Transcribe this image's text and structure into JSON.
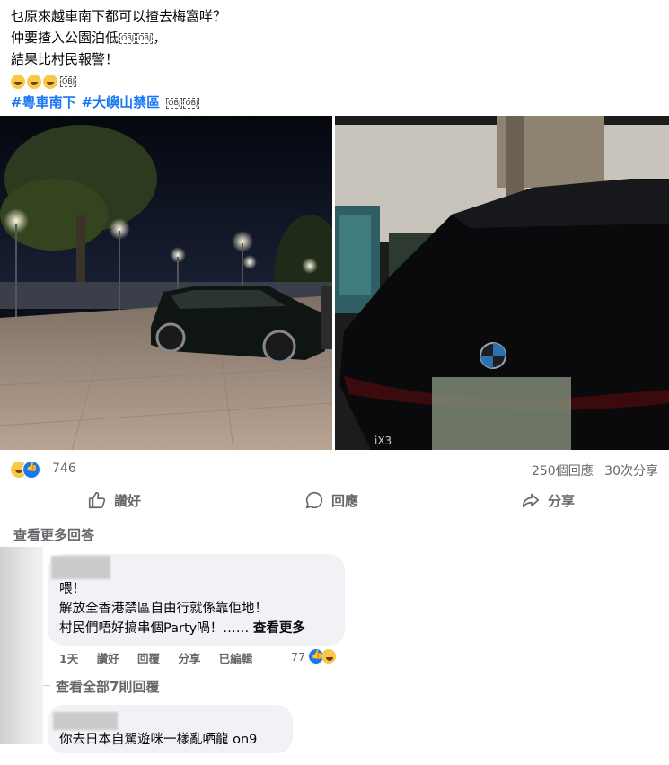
{
  "post": {
    "lines": [
      "乜原來越車南下都可以揸去梅窩咩？",
      "仲要揸入公園泊低",
      "結果比村民報警！"
    ],
    "object_marker": "OBJ",
    "hashtags": [
      "#粵車南下",
      "#大嶼山禁區"
    ]
  },
  "stats": {
    "reactions": "746",
    "comments": "250個回應",
    "shares": "30次分享"
  },
  "actions": {
    "like": "讚好",
    "comment": "回應",
    "share": "分享"
  },
  "comments_section": {
    "more_answers": "查看更多回答",
    "comment1": {
      "lines": [
        "喂！",
        "解放全香港禁區自由行就係靠佢地！",
        "村民們唔好搞串個Party喎！……"
      ],
      "see_more": "查看更多",
      "time": "1天",
      "like": "讚好",
      "reply": "回覆",
      "share": "分享",
      "edited": "已編輯",
      "reaction_count": "77"
    },
    "view_all_replies": "查看全部7則回覆",
    "comment2": {
      "text": "你去日本自駕遊咪一樣亂哂龍 on9"
    }
  },
  "photo_right": {
    "badge": "iX3"
  }
}
